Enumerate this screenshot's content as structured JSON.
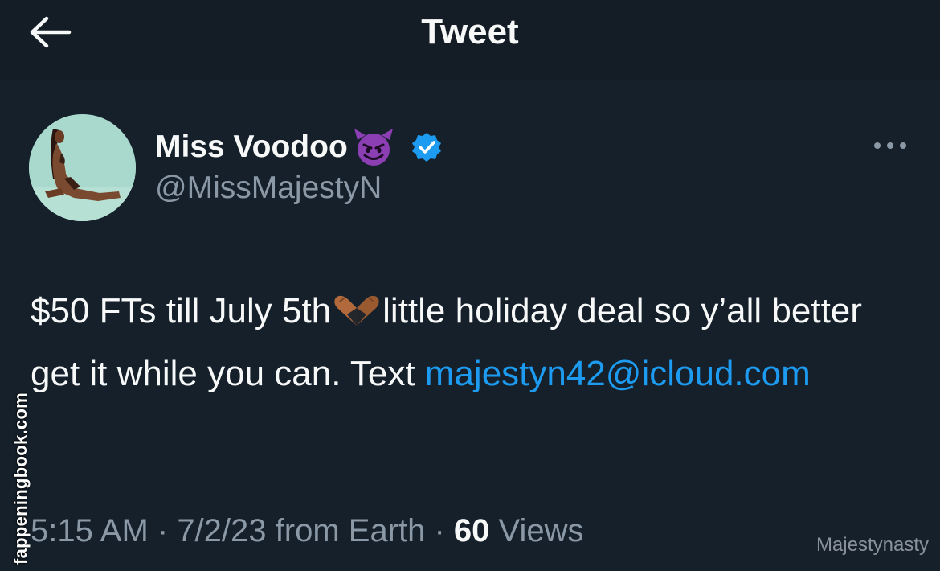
{
  "header": {
    "title": "Tweet",
    "back_icon": "arrow-left-icon"
  },
  "author": {
    "display_name": "Miss Voodoo",
    "name_emoji": "smiling-devil-icon",
    "verified_icon": "verified-badge-icon",
    "handle": "@MissMajestyN",
    "avatar_icon": "profile-photo"
  },
  "more_icon": "more-horizontal-icon",
  "tweet": {
    "text_part1": "$50 FTs till July 5th",
    "emoji": "heart-hands-icon",
    "text_part2": "little holiday deal so y’all better get it while you can. Text ",
    "email": "majestyn42@icloud.com"
  },
  "meta": {
    "time": "5:15 AM",
    "sep1": " · ",
    "date": "7/2/23",
    "source": " from Earth",
    "sep2": " · ",
    "views_count": "60",
    "views_label": " Views"
  },
  "watermarks": {
    "side": "fappeningbook.com",
    "corner": "Majestynasty"
  },
  "colors": {
    "background": "#15202b",
    "text": "#f7f9f9",
    "secondary": "#8b98a5",
    "link": "#1d9bf0",
    "verified": "#1d9bf0"
  }
}
